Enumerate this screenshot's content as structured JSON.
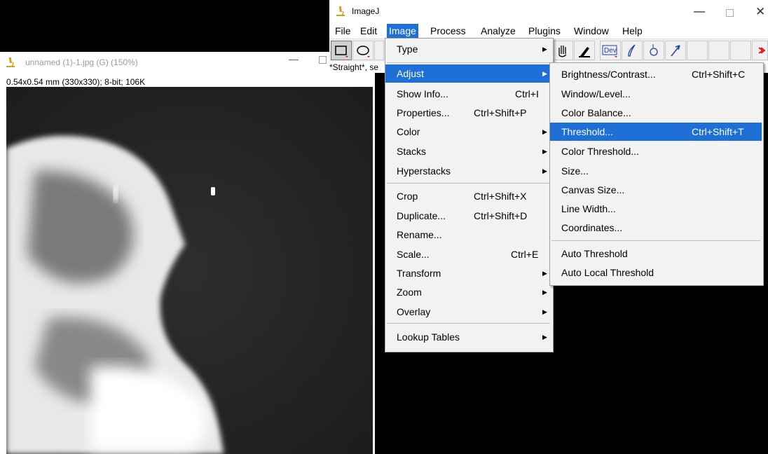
{
  "image_window": {
    "title": "unnamed (1)-1.jpg (G) (150%)",
    "info": "0.54x0.54 mm (330x330); 8-bit; 106K",
    "min_glyph": "—"
  },
  "imagej": {
    "title": "ImageJ",
    "min_glyph": "—",
    "close_glyph": "✕",
    "menubar": [
      "File",
      "Edit",
      "Image",
      "Process",
      "Analyze",
      "Plugins",
      "Window",
      "Help"
    ],
    "active_menu": "Image",
    "status": "*Straight*, se",
    "dev_label": "Dev"
  },
  "image_menu": {
    "items": [
      {
        "label": "Type",
        "accel": "",
        "submenu": true
      },
      {
        "label": "Adjust",
        "accel": "",
        "submenu": true
      },
      {
        "label": "Show Info...",
        "accel": "Ctrl+I",
        "submenu": false
      },
      {
        "label": "Properties...",
        "accel": "Ctrl+Shift+P",
        "submenu": false
      },
      {
        "label": "Color",
        "accel": "",
        "submenu": true
      },
      {
        "label": "Stacks",
        "accel": "",
        "submenu": true
      },
      {
        "label": "Hyperstacks",
        "accel": "",
        "submenu": true
      },
      {
        "label": "Crop",
        "accel": "Ctrl+Shift+X",
        "submenu": false
      },
      {
        "label": "Duplicate...",
        "accel": "Ctrl+Shift+D",
        "submenu": false
      },
      {
        "label": "Rename...",
        "accel": "",
        "submenu": false
      },
      {
        "label": "Scale...",
        "accel": "Ctrl+E",
        "submenu": false
      },
      {
        "label": "Transform",
        "accel": "",
        "submenu": true
      },
      {
        "label": "Zoom",
        "accel": "",
        "submenu": true
      },
      {
        "label": "Overlay",
        "accel": "",
        "submenu": true
      },
      {
        "label": "Lookup Tables",
        "accel": "",
        "submenu": true
      }
    ]
  },
  "adjust_menu": {
    "items": [
      {
        "label": "Brightness/Contrast...",
        "accel": "Ctrl+Shift+C"
      },
      {
        "label": "Window/Level...",
        "accel": ""
      },
      {
        "label": "Color Balance...",
        "accel": ""
      },
      {
        "label": "Threshold...",
        "accel": "Ctrl+Shift+T"
      },
      {
        "label": "Color Threshold...",
        "accel": ""
      },
      {
        "label": "Size...",
        "accel": ""
      },
      {
        "label": "Canvas Size...",
        "accel": ""
      },
      {
        "label": "Line Width...",
        "accel": ""
      },
      {
        "label": "Coordinates...",
        "accel": ""
      },
      {
        "label": "Auto Threshold",
        "accel": ""
      },
      {
        "label": "Auto Local Threshold",
        "accel": ""
      }
    ]
  },
  "colors": {
    "highlight": "#1e6fd6",
    "menu_bg": "#f2f2f2"
  }
}
